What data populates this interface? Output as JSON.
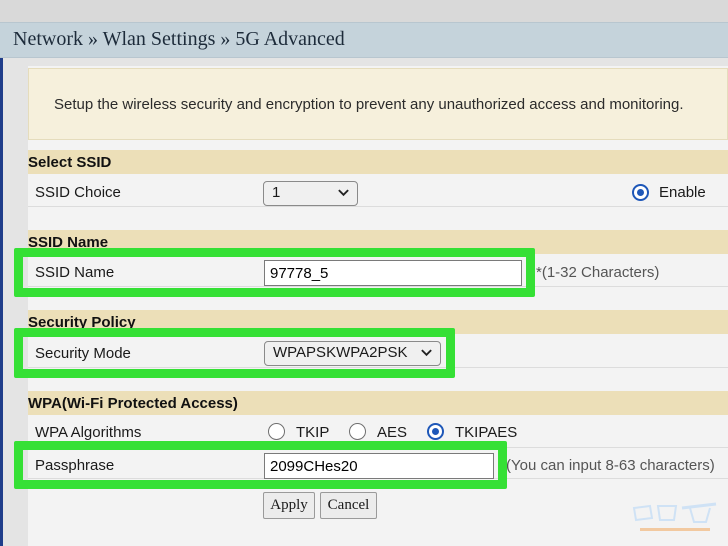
{
  "breadcrumb": "Network » Wlan Settings » 5G Advanced",
  "intro": "Setup the wireless security and encryption to prevent any unauthorized access and monitoring.",
  "sections": {
    "select_ssid": "Select SSID",
    "ssid_name": "SSID Name",
    "security_policy": "Security Policy",
    "wpa": "WPA(Wi-Fi Protected Access)"
  },
  "fields": {
    "ssid_choice": {
      "label": "SSID Choice",
      "value": "1",
      "enable_label": "Enable"
    },
    "ssid_name": {
      "label": "SSID Name",
      "value": "97778_5",
      "hint": "*(1-32 Characters)"
    },
    "security_mode": {
      "label": "Security Mode",
      "value": "WPAPSKWPA2PSK"
    },
    "wpa_algorithms": {
      "label": "WPA Algorithms",
      "options": [
        "TKIP",
        "AES",
        "TKIPAES"
      ],
      "selected": "TKIPAES"
    },
    "passphrase": {
      "label": "Passphrase",
      "value": "2099CHes20",
      "hint": "(You can input 8-63 characters)"
    }
  },
  "buttons": {
    "apply": "Apply",
    "cancel": "Cancel"
  },
  "colors": {
    "highlight": "#35e035",
    "accent": "#1e57b8",
    "section_bg": "#ecdfb8",
    "header_bg": "#c5d3db"
  }
}
